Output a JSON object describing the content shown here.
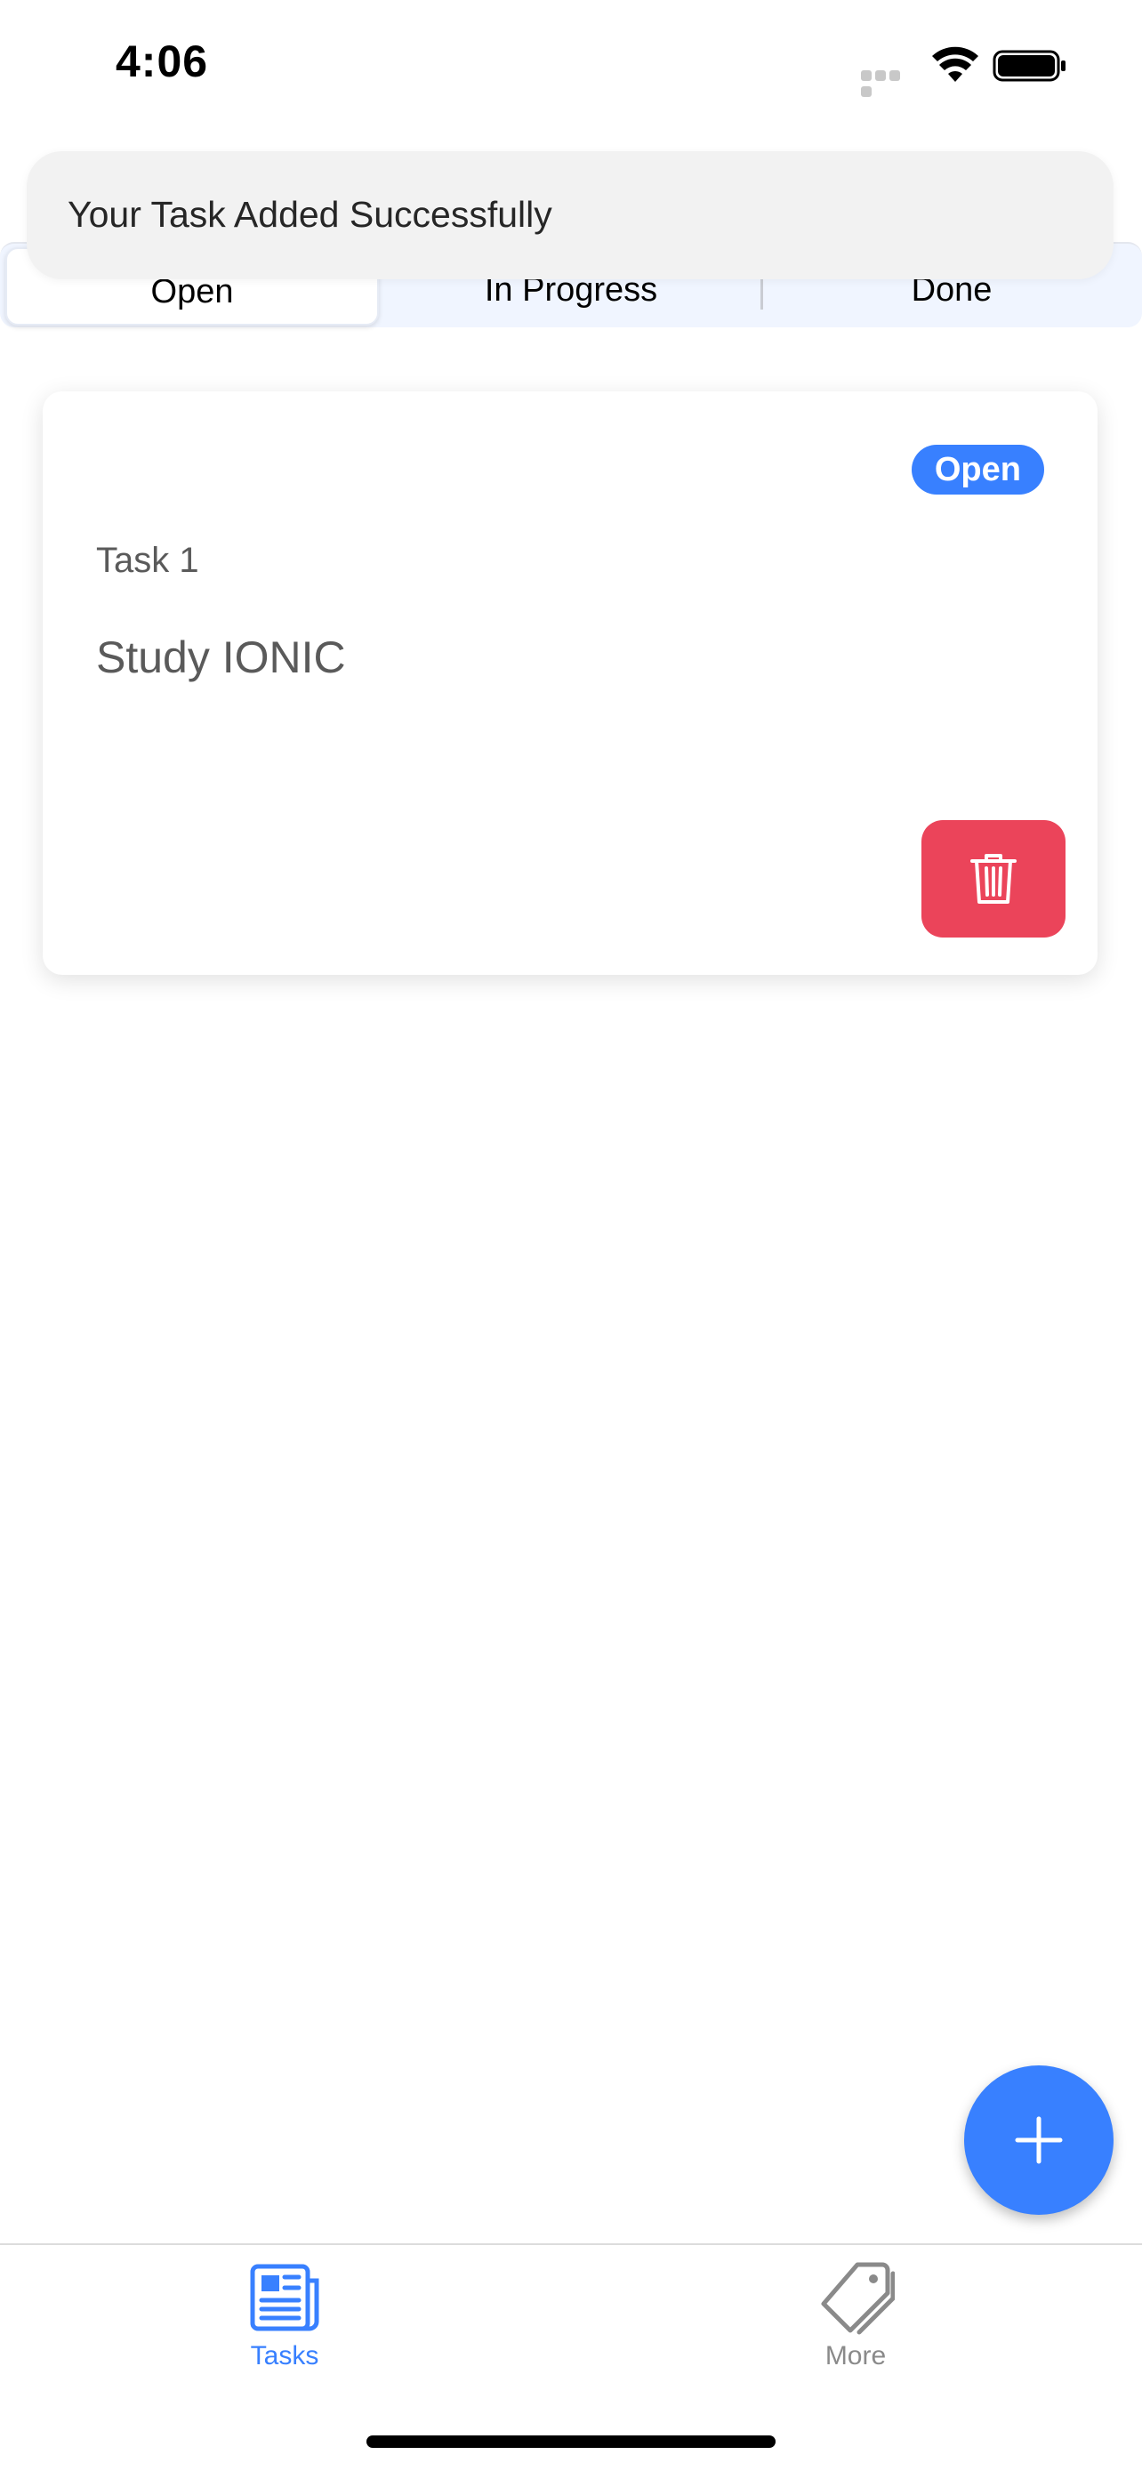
{
  "status_bar": {
    "time": "4:06"
  },
  "toast": {
    "message": "Your Task Added Successfully"
  },
  "segment": {
    "tabs": [
      {
        "label": "Open",
        "active": true
      },
      {
        "label": "In Progress",
        "active": false
      },
      {
        "label": "Done",
        "active": false
      }
    ]
  },
  "task_card": {
    "status_badge": "Open",
    "subtitle": "Task 1",
    "content": "Study IONIC",
    "delete_icon": "trash-icon"
  },
  "fab": {
    "icon": "add-icon"
  },
  "tab_bar": {
    "items": [
      {
        "label": "Tasks",
        "icon": "newspaper-icon",
        "selected": true
      },
      {
        "label": "More",
        "icon": "pricetags-icon",
        "selected": false
      }
    ]
  },
  "colors": {
    "primary": "#3880ff",
    "danger": "#eb445a",
    "toast_bg": "#f2f2f2",
    "segment_bg": "#f0f5ff"
  }
}
